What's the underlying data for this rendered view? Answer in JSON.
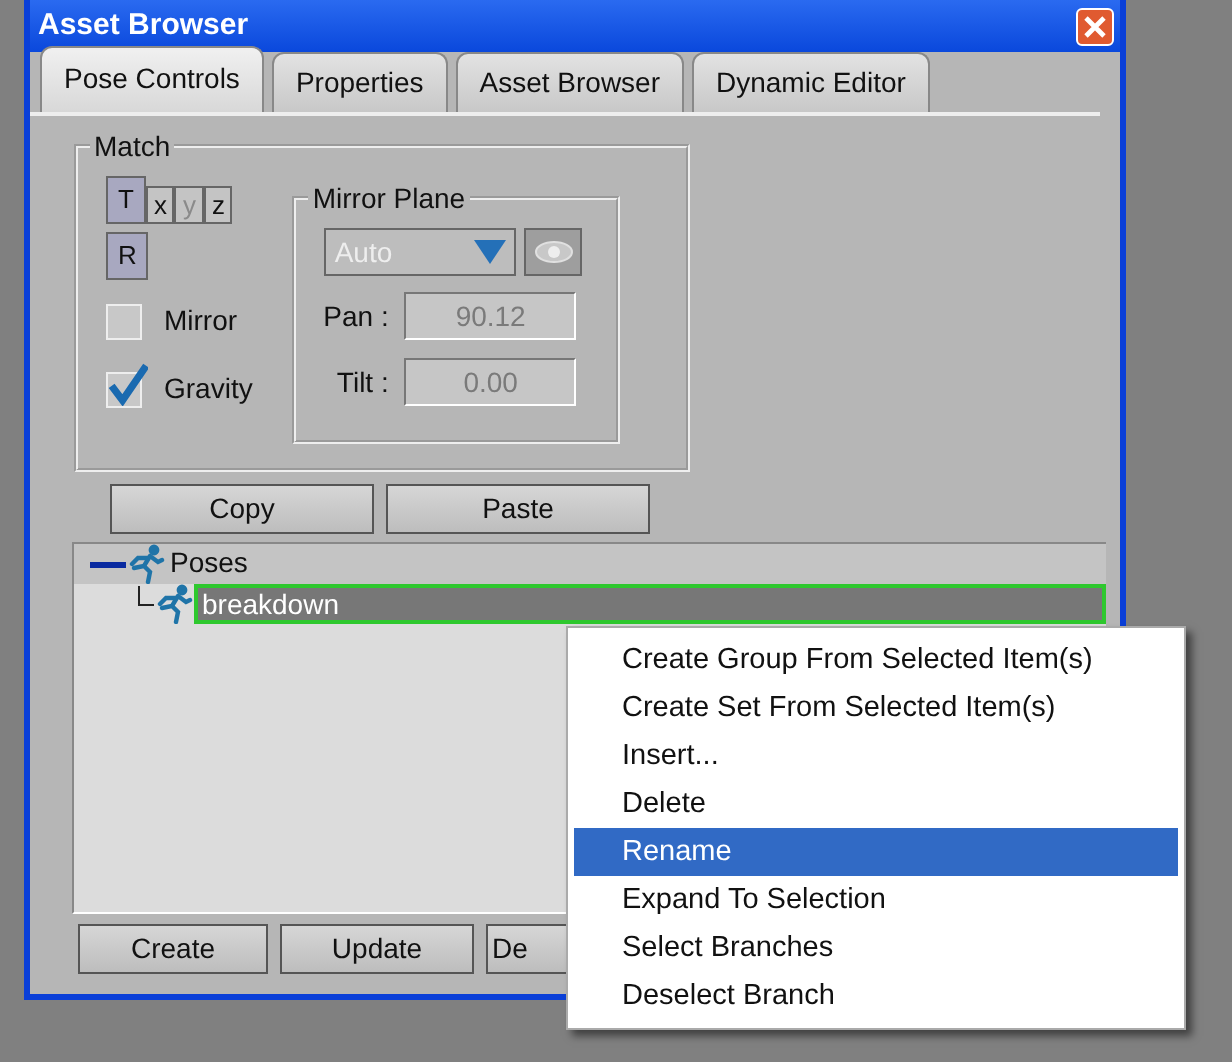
{
  "window": {
    "title": "Asset Browser"
  },
  "tabs": [
    {
      "label": "Pose Controls",
      "selected": true
    },
    {
      "label": "Properties",
      "selected": false
    },
    {
      "label": "Asset Browser",
      "selected": false
    },
    {
      "label": "Dynamic Editor",
      "selected": false
    }
  ],
  "match": {
    "title": "Match",
    "axis_buttons": [
      {
        "label": "T",
        "pressed": true,
        "disabled": false
      },
      {
        "label": "x",
        "pressed": false,
        "disabled": false
      },
      {
        "label": "y",
        "pressed": false,
        "disabled": true
      },
      {
        "label": "z",
        "pressed": false,
        "disabled": false
      }
    ],
    "rotate_button": {
      "label": "R",
      "pressed": true
    },
    "checkboxes": [
      {
        "label": "Mirror",
        "checked": false
      },
      {
        "label": "Gravity",
        "checked": true
      }
    ],
    "mirror_plane": {
      "title": "Mirror Plane",
      "dropdown": {
        "value": "Auto",
        "disabled": true
      },
      "fields": [
        {
          "label": "Pan :",
          "value": "90.12",
          "disabled": true
        },
        {
          "label": "Tilt :",
          "value": "0.00",
          "disabled": true
        }
      ]
    }
  },
  "actions": [
    "Copy",
    "Paste"
  ],
  "tree": {
    "items": [
      {
        "label": "Poses",
        "expanded": true,
        "selected": false,
        "children": [
          {
            "label": "breakdown",
            "selected": true
          }
        ]
      }
    ]
  },
  "bottom_buttons": [
    "Create",
    "Update",
    "De"
  ],
  "context_menu": {
    "items": [
      {
        "label": "Create Group From Selected Item(s)",
        "selected": false
      },
      {
        "label": "Create Set From Selected Item(s)",
        "selected": false
      },
      {
        "label": "Insert...",
        "selected": false
      },
      {
        "label": "Delete",
        "selected": false
      },
      {
        "label": "Rename",
        "selected": true
      },
      {
        "label": "Expand To Selection",
        "selected": false
      },
      {
        "label": "Select Branches",
        "selected": false
      },
      {
        "label": "Deselect Branch",
        "selected": false
      }
    ]
  }
}
